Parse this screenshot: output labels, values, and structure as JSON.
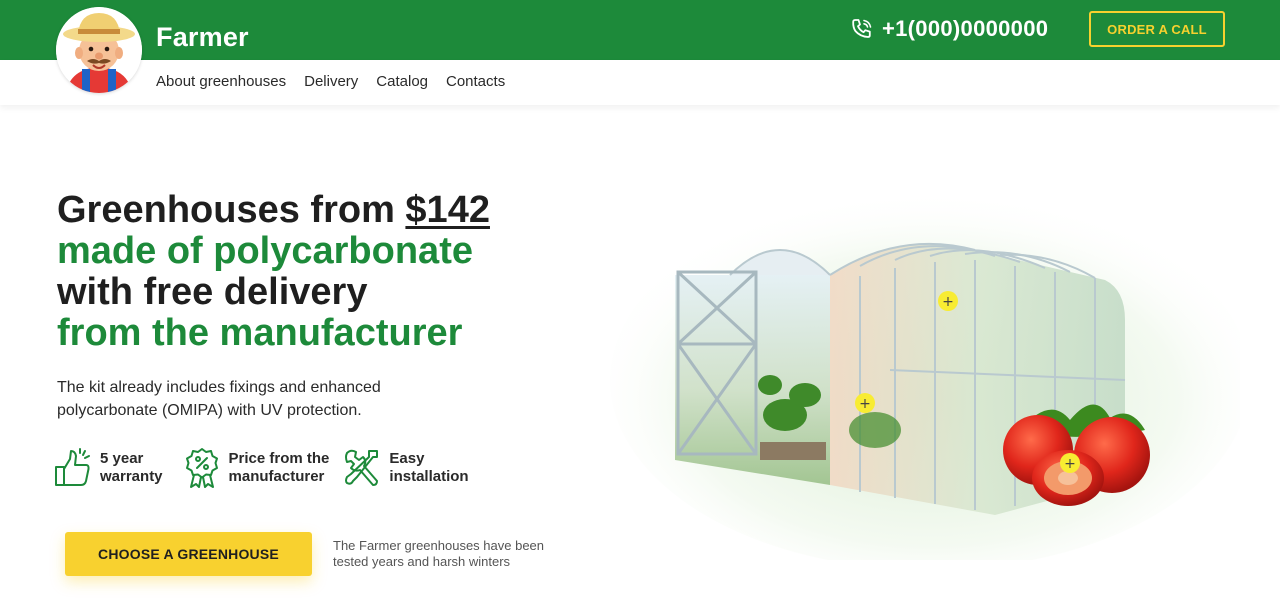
{
  "header": {
    "brand": "Farmer",
    "phone": "+1(000)0000000",
    "order_label": "ORDER A CALL",
    "nav": [
      "About greenhouses",
      "Delivery",
      "Catalog",
      "Contacts"
    ]
  },
  "hero": {
    "line1_prefix": "Greenhouses from ",
    "line1_price": "$142",
    "line2": "made of polycarbonate",
    "line3": "with free delivery",
    "line4": "from the manufacturer",
    "description": "The kit already includes fixings and enhanced polycarbonate (OMIPA) with UV protection.",
    "features": [
      {
        "icon": "thumbs-up-icon",
        "line1": "5 year",
        "line2": "warranty"
      },
      {
        "icon": "percent-badge-icon",
        "line1": "Price from the",
        "line2": "manufacturer"
      },
      {
        "icon": "tools-icon",
        "line1": "Easy",
        "line2": "installation"
      }
    ],
    "cta_label": "CHOOSE A GREENHOUSE",
    "tested_note": "The Farmer greenhouses have been tested years and harsh winters"
  },
  "colors": {
    "brand_green": "#1d8a3a",
    "accent_yellow": "#f8d12f"
  }
}
